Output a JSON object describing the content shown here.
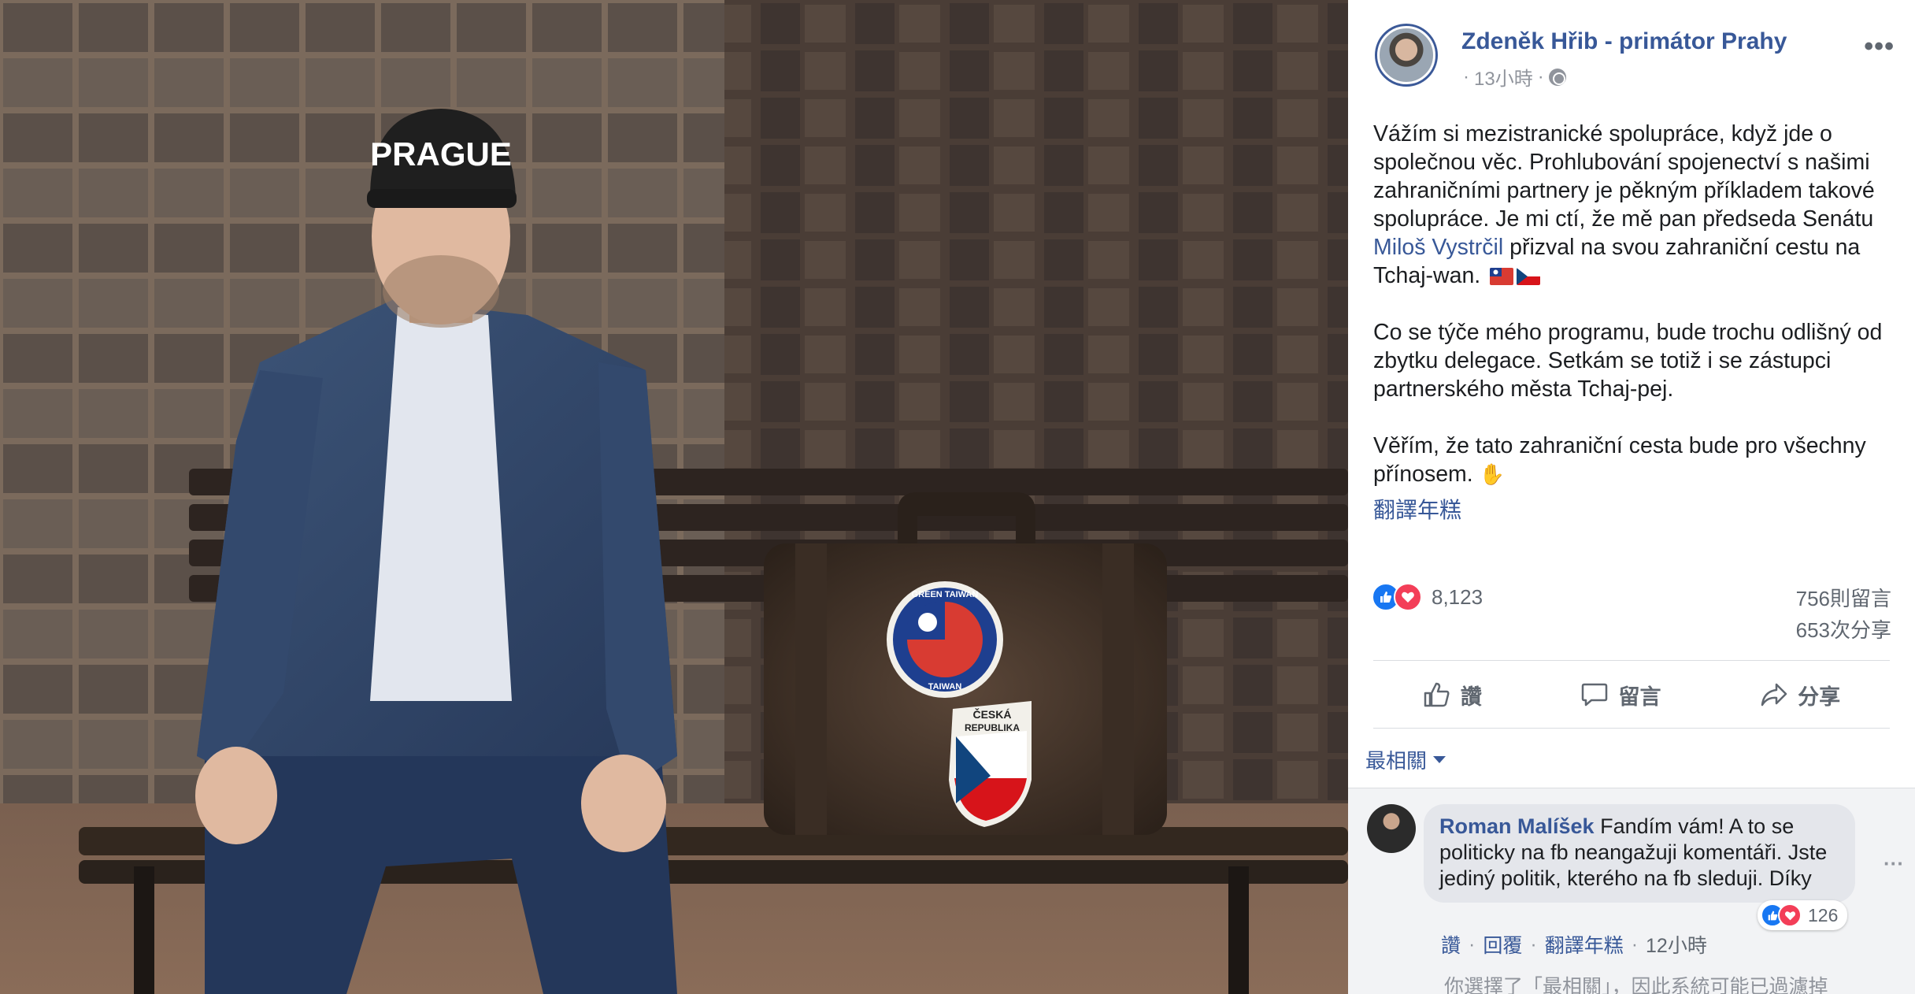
{
  "photo": {
    "cap_text": "PRAGUE",
    "sticker_taiwan_text": "GREEN TAIWAN",
    "sticker_taiwan_text_2": "TAIWAN",
    "sticker_czech_line1": "ČESKÁ",
    "sticker_czech_line2": "REPUBLIKA"
  },
  "post": {
    "page_name": "Zdeněk Hřib - primátor Prahy",
    "time": "13小時",
    "separator": "·",
    "paragraph1_a": "Vážím si mezistranické spolupráce, když jde o společnou věc. Prohlubování spojenectví s našimi zahraničními partnery je pěkným příkladem takové spolupráce. Je mi ctí, že mě pan předseda Senátu ",
    "paragraph1_link": "Miloš Vystrčil",
    "paragraph1_b": " přizval na svou zahraniční cestu na Tchaj-wan.",
    "paragraph2": "Co se týče mého programu, bude trochu odlišný od zbytku delegace. Setkám se totiž i se zástupci partnerského města Tchaj-pej.",
    "paragraph3": "Věřím, že tato zahraniční cesta bude pro všechny přínosem.",
    "see_translation": "翻譯年糕",
    "reaction_count": "8,123",
    "comment_count": "756則留言",
    "share_count": "653次分享",
    "more_label": "•••"
  },
  "actions": {
    "like": "讚",
    "comment": "留言",
    "share": "分享"
  },
  "sort": {
    "label": "最相關"
  },
  "comment": {
    "author": "Roman Malíšek",
    "text": "Fandím vám! A to se politicky na fb neangažuji komentáři. Jste jediný politik, kterého na fb sleduji. Díky",
    "reaction_count": "126",
    "like": "讚",
    "reply": "回覆",
    "translate": "翻譯年糕",
    "time": "12小時",
    "dot": "·",
    "more": "···"
  },
  "filter_note": "你選擇了「最相關」，因此系統可能已過濾掉",
  "colors": {
    "link": "#385898",
    "like_blue": "#1877f2",
    "love_red": "#f33e58",
    "muted": "#606770"
  },
  "icons": [
    "more-icon",
    "globe-icon",
    "like-icon",
    "love-icon",
    "thumb-up-outline-icon",
    "comment-bubble-icon",
    "share-arrow-icon",
    "caret-down-icon",
    "taiwan-flag-icon",
    "czech-flag-icon",
    "thumbs-up-emoji-icon"
  ]
}
